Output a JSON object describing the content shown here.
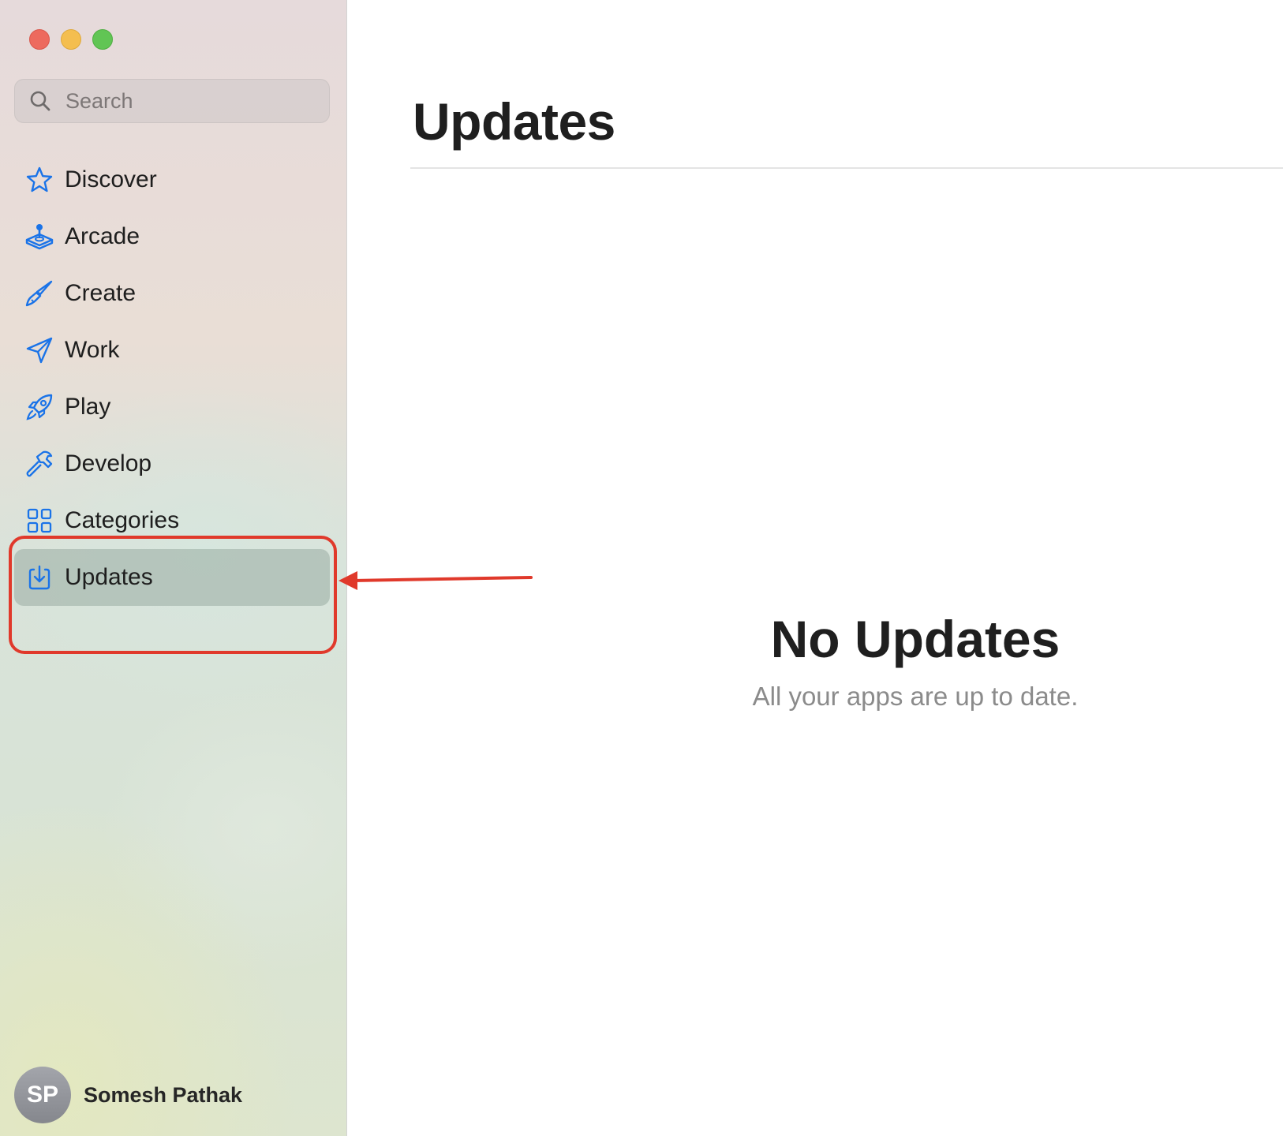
{
  "window": {
    "traffic_lights": [
      "close",
      "minimize",
      "zoom"
    ]
  },
  "search": {
    "placeholder": "Search",
    "icon": "magnifying-glass-icon"
  },
  "sidebar": {
    "accent_color": "#1a73e8",
    "items": [
      {
        "label": "Discover",
        "icon": "star-icon",
        "selected": false
      },
      {
        "label": "Arcade",
        "icon": "joystick-icon",
        "selected": false
      },
      {
        "label": "Create",
        "icon": "paintbrush-icon",
        "selected": false
      },
      {
        "label": "Work",
        "icon": "paperplane-icon",
        "selected": false
      },
      {
        "label": "Play",
        "icon": "rocket-icon",
        "selected": false
      },
      {
        "label": "Develop",
        "icon": "hammer-icon",
        "selected": false
      },
      {
        "label": "Categories",
        "icon": "grid-icon",
        "selected": false
      },
      {
        "label": "Updates",
        "icon": "download-icon",
        "selected": true
      }
    ]
  },
  "profile": {
    "initials": "SP",
    "name": "Somesh Pathak"
  },
  "main": {
    "title": "Updates",
    "empty_title": "No Updates",
    "empty_subtitle": "All your apps are up to date."
  },
  "annotation": {
    "color": "#e0392b"
  }
}
